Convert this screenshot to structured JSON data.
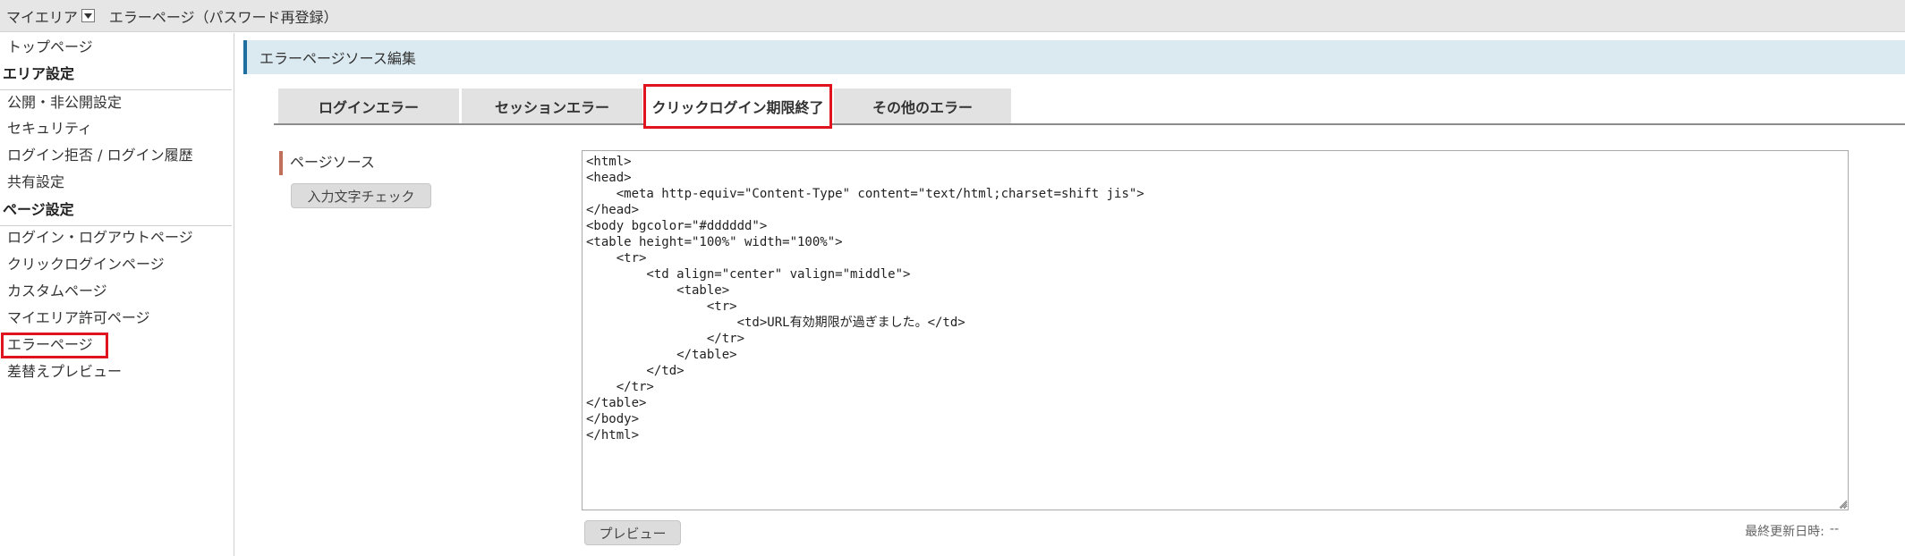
{
  "topbar": {
    "myarea_label": "マイエリア",
    "breadcrumb": "エラーページ（パスワード再登録）"
  },
  "sidebar": {
    "top_page": "トップページ",
    "area_settings_heading": "エリア設定",
    "area_items": [
      "公開・非公開設定",
      "セキュリティ",
      "ログイン拒否 / ログイン履歴",
      "共有設定"
    ],
    "page_settings_heading": "ページ設定",
    "page_items": [
      "ログイン・ログアウトページ",
      "クリックログインページ",
      "カスタムページ",
      "マイエリア許可ページ",
      "エラーページ",
      "差替えプレビュー"
    ],
    "active_item": "エラーページ"
  },
  "main": {
    "section_title": "エラーページソース編集",
    "tabs": [
      {
        "label": "ログインエラー",
        "active": false
      },
      {
        "label": "セッションエラー",
        "active": false
      },
      {
        "label": "クリックログイン期限終了",
        "active": true
      },
      {
        "label": "その他のエラー",
        "active": false
      }
    ],
    "field_label": "ページソース",
    "check_button": "入力文字チェック",
    "source": "<html>\n<head>\n    <meta http-equiv=\"Content-Type\" content=\"text/html;charset=shift jis\">\n</head>\n<body bgcolor=\"#dddddd\">\n<table height=\"100%\" width=\"100%\">\n    <tr>\n        <td align=\"center\" valign=\"middle\">\n            <table>\n                <tr>\n                    <td>URL有効期限が過ぎました。</td>\n                </tr>\n            </table>\n        </td>\n    </tr>\n</table>\n</body>\n</html>",
    "preview_button": "プレビュー",
    "last_updated_label": "最終更新日時:",
    "last_updated_value": "--"
  },
  "colors": {
    "highlight": "#e0141e",
    "header_bg": "#dbe9f1",
    "header_accent": "#1e6fa0",
    "label_accent": "#c0705a"
  },
  "icons": {
    "myarea_dropdown": "chevron-down-icon",
    "resize": "resize-grip-icon"
  }
}
